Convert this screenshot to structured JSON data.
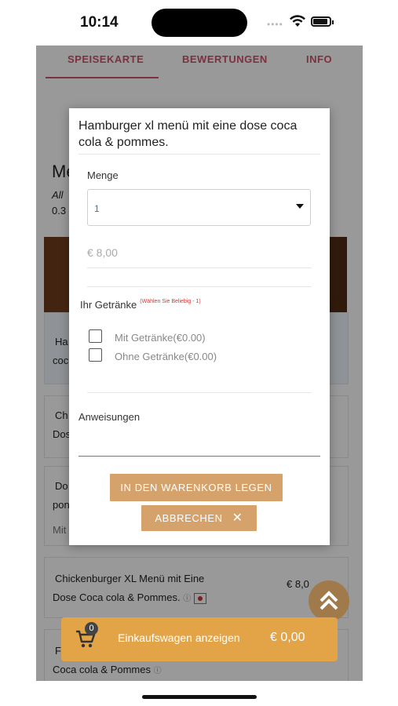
{
  "status": {
    "time": "10:14"
  },
  "tabs": [
    "SPEISEKARTE",
    "BEWERTUNGEN",
    "INFO"
  ],
  "background": {
    "section_heading": "Me",
    "desc_line1": "All",
    "desc_line2": "0.3",
    "card1": {
      "line1": "Ha",
      "line2": "coc"
    },
    "card2": {
      "line1": "Ch",
      "line2": "Dos"
    },
    "card3": {
      "line1": "Do",
      "line2": "pon",
      "line3": "Mit"
    },
    "card4": {
      "line1": "Chickenburger XL Menü mit Eine",
      "line2": "Dose Coca cola & Pommes.",
      "price": "€ 8,0"
    },
    "card5": {
      "line1": "F",
      "line2": "Coca cola & Pommes"
    }
  },
  "cart": {
    "count": "0",
    "label": "Einkaufswagen anzeigen",
    "total": "€ 0,00"
  },
  "modal": {
    "title": "Hamburger xl menü mit eine dose coca cola & pommes.",
    "quantity_label": "Menge",
    "quantity_value": "1",
    "price": "€ 8,00",
    "drinks_label": "Ihr Getränke",
    "drinks_hint": "(Wählen Sie Beliebig - 1)",
    "options": [
      {
        "label": "Mit Getränke(€0.00)"
      },
      {
        "label": "Ohne Getränke(€0.00)"
      }
    ],
    "instructions_label": "Anweisungen",
    "add_button": "IN DEN WARENKORB LEGEN",
    "cancel_button": "ABBRECHEN"
  },
  "colors": {
    "accent": "#d0506b",
    "button": "#d6a26b",
    "cart_bar": "#e3a447"
  }
}
